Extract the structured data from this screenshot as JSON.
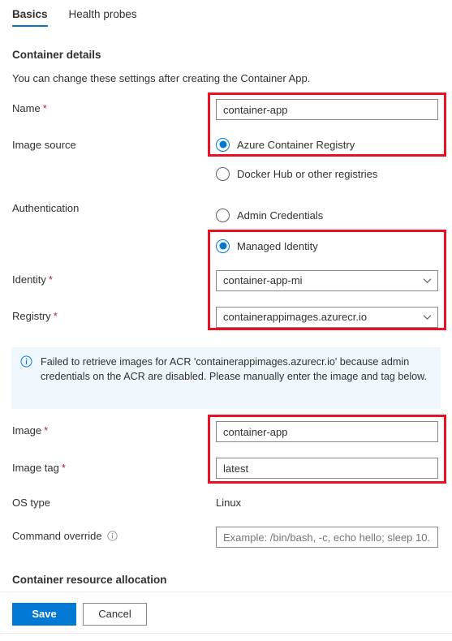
{
  "tabs": [
    {
      "label": "Basics",
      "active": true
    },
    {
      "label": "Health probes",
      "active": false
    }
  ],
  "container_details": {
    "heading": "Container details",
    "description": "You can change these settings after creating the Container App."
  },
  "fields": {
    "name": {
      "label": "Name",
      "required_mark": "*",
      "value": "container-app"
    },
    "image_source": {
      "label": "Image source",
      "options": [
        {
          "label": "Azure Container Registry",
          "selected": true
        },
        {
          "label": "Docker Hub or other registries",
          "selected": false
        }
      ]
    },
    "authentication": {
      "label": "Authentication",
      "options": [
        {
          "label": "Admin Credentials",
          "selected": false
        },
        {
          "label": "Managed Identity",
          "selected": true
        }
      ]
    },
    "identity": {
      "label": "Identity",
      "required_mark": "*",
      "value": "container-app-mi"
    },
    "registry": {
      "label": "Registry",
      "required_mark": "*",
      "value": "containerappimages.azurecr.io"
    },
    "image": {
      "label": "Image",
      "required_mark": "*",
      "value": "container-app"
    },
    "image_tag": {
      "label": "Image tag",
      "required_mark": "*",
      "value": "latest"
    },
    "os_type": {
      "label": "OS type",
      "value": "Linux"
    },
    "command_override": {
      "label": "Command override",
      "placeholder": "Example: /bin/bash, -c, echo hello; sleep 10..."
    }
  },
  "info_message": {
    "text": "Failed to retrieve images for ACR 'containerappimages.azurecr.io' because admin credentials on the ACR are disabled. Please manually enter the image and tag below."
  },
  "resource_allocation": {
    "heading": "Container resource allocation"
  },
  "footer": {
    "save_label": "Save",
    "cancel_label": "Cancel"
  },
  "colors": {
    "accent": "#0078d4",
    "highlight": "#e81123",
    "required": "#a4262c",
    "info_bg": "#eff6fc"
  }
}
